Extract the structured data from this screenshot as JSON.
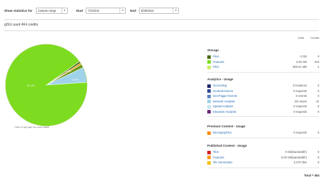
{
  "toolbar": {
    "show_stats_label": "Show statistics for",
    "range_value": "Custom range",
    "start_label": "Start",
    "start_value": "7/1/2014",
    "end_label": "End",
    "end_value": "8/29/2014"
  },
  "credits_title": "gISU used 464 credits",
  "pie": {
    "note": "Click or tap slice for more detail",
    "slices": [
      {
        "name": "Features",
        "fraction": 0.912,
        "color": "#7ddc1f",
        "label": "91.2%"
      },
      {
        "name": "Storage Features (dark)",
        "fraction": 0.008,
        "color": "#4b6b12",
        "label": ""
      },
      {
        "name": "Orange",
        "fraction": 0.006,
        "color": "#ff8c00",
        "label": ""
      },
      {
        "name": "Features (dark green)",
        "fraction": 0.014,
        "color": "#6a9a1a",
        "label": "6.3%"
      },
      {
        "name": "Network Analysis",
        "fraction": 0.06,
        "color": "#9fd3ea",
        "label": "6.0%"
      }
    ]
  },
  "panel": {
    "col_units": "Units",
    "col_credits": "Credits",
    "sections": [
      {
        "title": "Storage",
        "rows": [
          {
            "label": "Files",
            "units": "0 GB",
            "credits": "0",
            "color": "#4b6b12"
          },
          {
            "label": "Features",
            "units": "0.92 GB",
            "credits": "433",
            "color": "#7ddc1f"
          },
          {
            "label": "Files",
            "units": "506.01 MB",
            "credits": "1",
            "color": "#c7f063"
          }
        ]
      },
      {
        "title": "Analytics - Usage",
        "rows": [
          {
            "label": "Geocoding",
            "units": "0 locations",
            "credits": "0",
            "color": "#1f2a6b"
          },
          {
            "label": "GeoEnrichment",
            "units": "0 requests",
            "credits": "0",
            "color": "#2e4a9a"
          },
          {
            "label": "GeoTrigger Events",
            "units": "0 events",
            "credits": "0",
            "color": "#5b86c7"
          },
          {
            "label": "Network Analysis",
            "units": "83 routes",
            "credits": "41",
            "color": "#9fd3ea"
          },
          {
            "label": "Spatial Analysis",
            "units": "0 requests",
            "credits": "0",
            "color": "#c6e4f2"
          },
          {
            "label": "Elevation Analysis",
            "units": "0 requests",
            "credits": "0",
            "color": "#6a2a7a"
          }
        ]
      },
      {
        "title": "Premium Content - Usage",
        "rows": [
          {
            "label": "Demographics",
            "units": "0 requests",
            "credits": "0",
            "color": "#ff8c00"
          }
        ]
      },
      {
        "title": "Published Content - Usage",
        "rows": [
          {
            "label": "Tiles",
            "units": "0 GB(bandwidth)",
            "credits": "0",
            "color": "#d81e1e"
          },
          {
            "label": "Features",
            "units": "0.00 GB(bandwidth)",
            "credits": "0",
            "color": "#ff9a1a"
          },
          {
            "label": "Tile Generation",
            "units": "3,270 tiles",
            "credits": "0",
            "color": "#f2c200"
          }
        ]
      }
    ],
    "total": "Total = 464"
  }
}
